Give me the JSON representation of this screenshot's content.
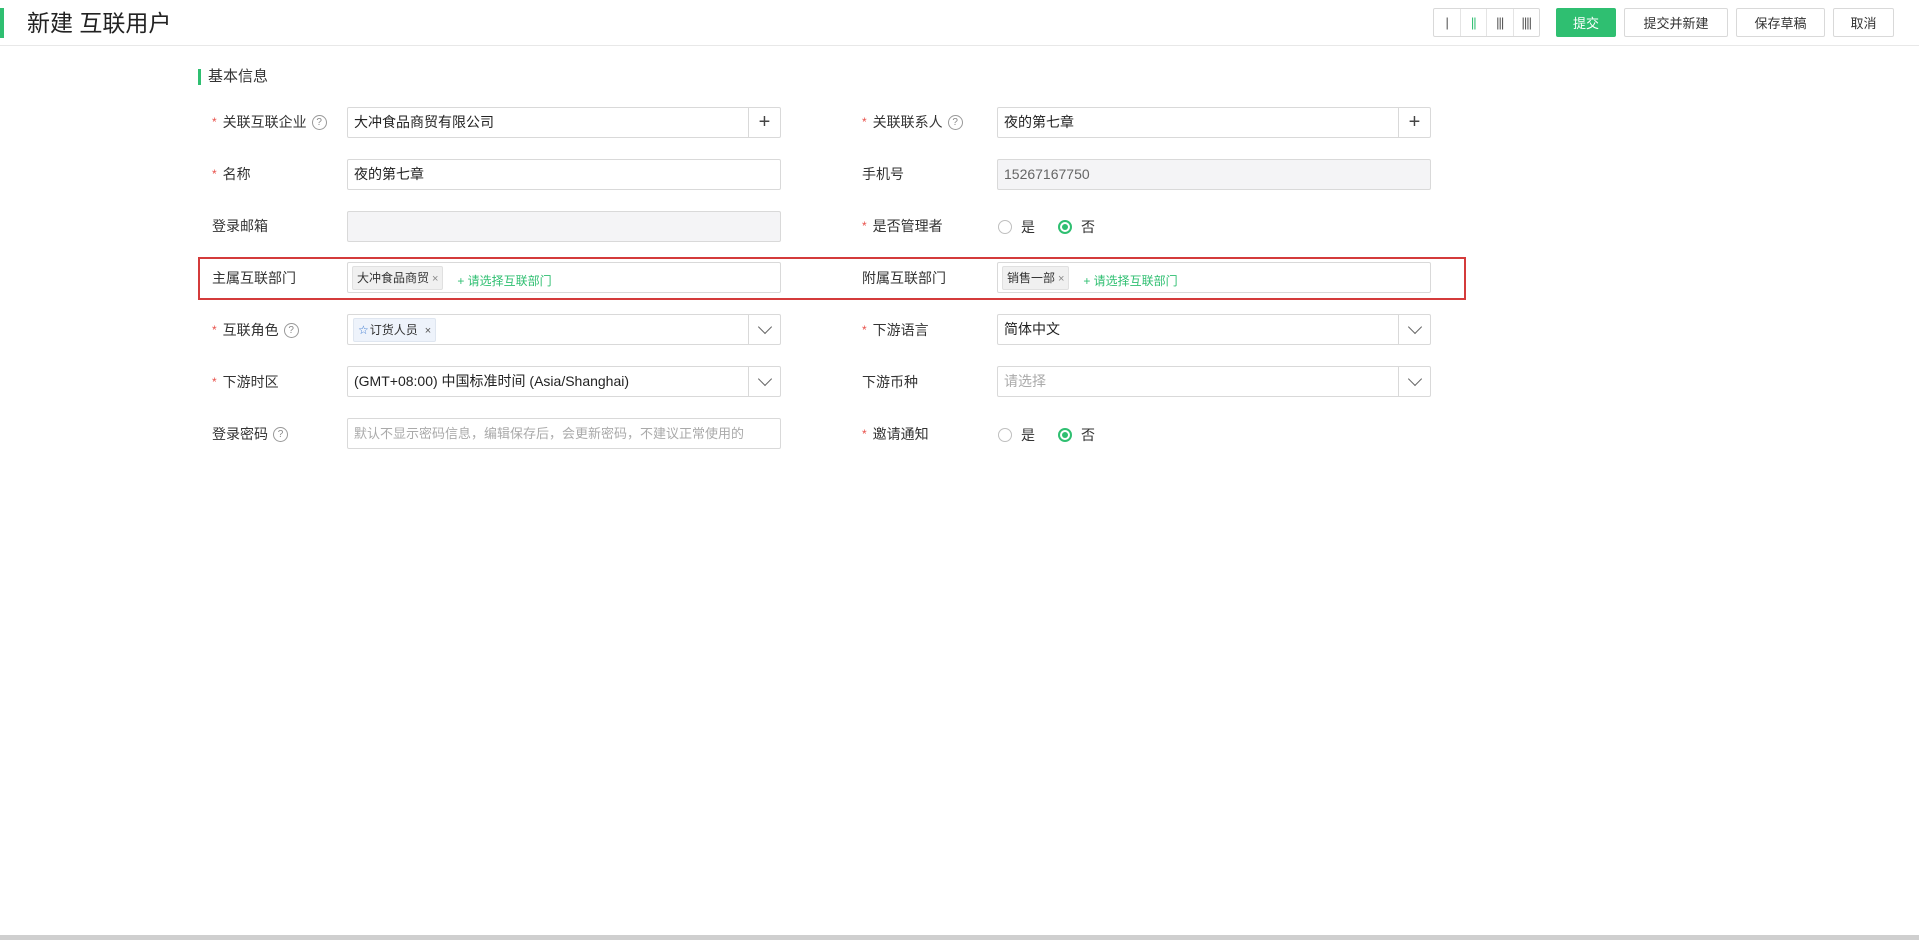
{
  "header": {
    "title": "新建 互联用户",
    "layout_options": [
      "|",
      "||",
      "|||",
      "||||"
    ],
    "buttons": {
      "submit": "提交",
      "submit_new": "提交并新建",
      "save_draft": "保存草稿",
      "cancel": "取消"
    }
  },
  "section": {
    "title": "基本信息"
  },
  "form": {
    "linked_company": {
      "label": "关联互联企业",
      "value": "大冲食品商贸有限公司"
    },
    "linked_contact": {
      "label": "关联联系人",
      "value": "夜的第七章"
    },
    "name": {
      "label": "名称",
      "value": "夜的第七章"
    },
    "phone": {
      "label": "手机号",
      "value": "15267167750"
    },
    "email": {
      "label": "登录邮箱",
      "value": ""
    },
    "is_admin": {
      "label": "是否管理者",
      "yes": "是",
      "no": "否",
      "selected": "否"
    },
    "main_dept": {
      "label": "主属互联部门",
      "tag": "大冲食品商贸",
      "add": "+ 请选择互联部门"
    },
    "sub_dept": {
      "label": "附属互联部门",
      "tag": "销售一部",
      "add": "+ 请选择互联部门"
    },
    "role": {
      "label": "互联角色",
      "tag": "订货人员"
    },
    "language": {
      "label": "下游语言",
      "value": "简体中文"
    },
    "timezone": {
      "label": "下游时区",
      "value": "(GMT+08:00) 中国标准时间 (Asia/Shanghai)"
    },
    "currency": {
      "label": "下游币种",
      "placeholder": "请选择"
    },
    "password": {
      "label": "登录密码",
      "placeholder": "默认不显示密码信息，编辑保存后，会更新密码，不建议正常使用的"
    },
    "invite": {
      "label": "邀请通知",
      "yes": "是",
      "no": "否",
      "selected": "否"
    }
  },
  "colors": {
    "accent": "#2fbf71",
    "required": "#e8504a",
    "highlight": "#d43b3b"
  },
  "icons": {
    "help": "help-circle-icon",
    "add": "plus-icon",
    "dropdown": "chevron-down-icon",
    "remove": "close-icon",
    "role": "star-icon"
  }
}
